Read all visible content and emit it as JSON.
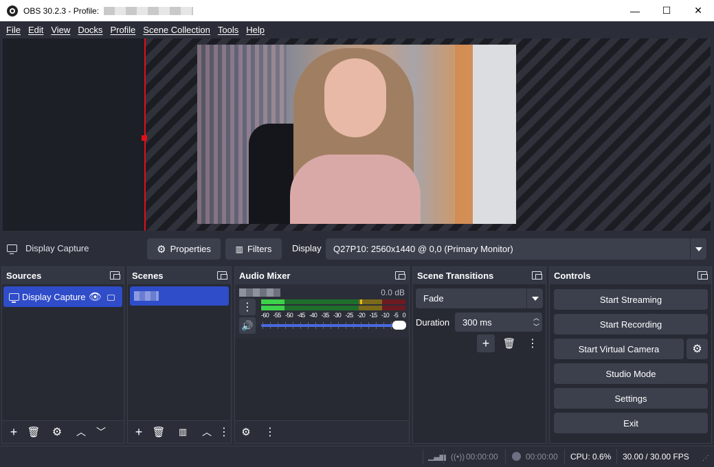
{
  "window": {
    "title": "OBS 30.2.3 - Profile: ",
    "minimize": "—",
    "maximize": "☐",
    "close": "✕"
  },
  "menu": [
    "File",
    "Edit",
    "View",
    "Docks",
    "Profile",
    "Scene Collection",
    "Tools",
    "Help"
  ],
  "source_toolbar": {
    "source_name": "Display Capture",
    "properties_label": "Properties",
    "filters_label": "Filters",
    "display_label": "Display",
    "display_value": "Q27P10: 2560x1440 @ 0,0 (Primary Monitor)"
  },
  "sources": {
    "title": "Sources",
    "items": [
      {
        "label": "Display Capture",
        "selected": true,
        "visible": true,
        "locked": true
      }
    ]
  },
  "scenes": {
    "title": "Scenes",
    "items": [
      {
        "label": "",
        "selected": true
      }
    ]
  },
  "audio_mixer": {
    "title": "Audio Mixer",
    "channel": {
      "name": "",
      "db": "0.0 dB"
    },
    "scale": [
      "-60",
      "-55",
      "-50",
      "-45",
      "-40",
      "-35",
      "-30",
      "-25",
      "-20",
      "-15",
      "-10",
      "-5",
      "0"
    ],
    "volume_fraction": 1.0
  },
  "scene_transitions": {
    "title": "Scene Transitions",
    "transition": "Fade",
    "duration_label": "Duration",
    "duration_value": "300 ms"
  },
  "controls": {
    "title": "Controls",
    "start_streaming": "Start Streaming",
    "start_recording": "Start Recording",
    "start_virtual_camera": "Start Virtual Camera",
    "studio_mode": "Studio Mode",
    "settings": "Settings",
    "exit": "Exit"
  },
  "status": {
    "stream_time": "00:00:00",
    "record_time": "00:00:00",
    "cpu": "CPU: 0.6%",
    "fps": "30.00 / 30.00 FPS"
  },
  "colors": {
    "background": "#2b2e38",
    "selection": "#2f4cc9",
    "button": "#3c404d",
    "preview_guide": "#e0101a"
  }
}
